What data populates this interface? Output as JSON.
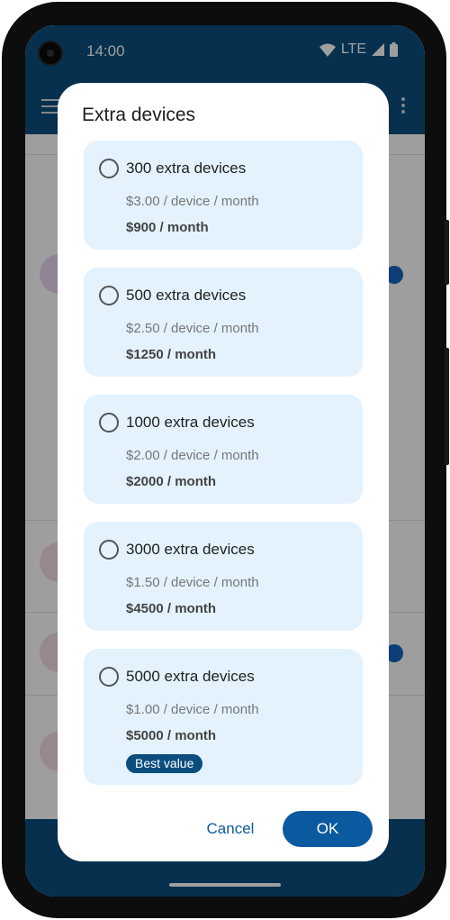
{
  "status_bar": {
    "time": "14:00",
    "network": "LTE"
  },
  "dialog": {
    "title": "Extra devices",
    "options": [
      {
        "label": "300 extra devices",
        "unit_price": "$3.00 / device / month",
        "total": "$900 / month",
        "selected": false
      },
      {
        "label": "500 extra devices",
        "unit_price": "$2.50 / device / month",
        "total": "$1250 / month",
        "selected": false
      },
      {
        "label": "1000 extra devices",
        "unit_price": "$2.00 / device / month",
        "total": "$2000 / month",
        "selected": false
      },
      {
        "label": "3000 extra devices",
        "unit_price": "$1.50 / device / month",
        "total": "$4500 / month",
        "selected": false
      },
      {
        "label": "5000 extra devices",
        "unit_price": "$1.00 / device / month",
        "total": "$5000 / month",
        "selected": false,
        "badge": "Best value"
      }
    ],
    "cancel_label": "Cancel",
    "ok_label": "OK"
  },
  "colors": {
    "app_bar": "#0b4e7e",
    "option_bg": "#e3f2fd",
    "accent": "#0b5aa0",
    "badge_bg": "#0b4e7e"
  },
  "icons": [
    "camera-icon",
    "wifi-icon",
    "signal-icon",
    "battery-icon",
    "menu-icon",
    "more-vert-icon",
    "radio-unchecked-icon"
  ]
}
